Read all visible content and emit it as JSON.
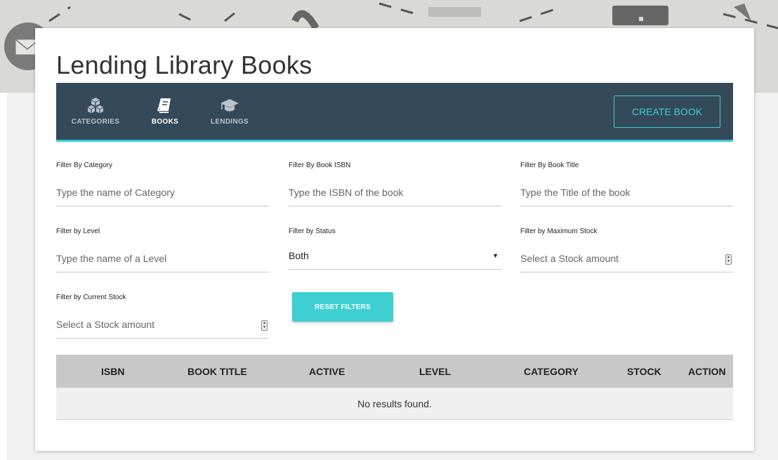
{
  "page": {
    "title": "Lending Library Books"
  },
  "nav": {
    "tabs": [
      {
        "label": "CATEGORIES",
        "icon": "boxes-icon",
        "active": false
      },
      {
        "label": "BOOKS",
        "icon": "book-icon",
        "active": true
      },
      {
        "label": "LENDINGS",
        "icon": "graduation-cap-icon",
        "active": false
      }
    ],
    "create_label": "CREATE BOOK"
  },
  "filters": {
    "category": {
      "label": "Filter By Category",
      "placeholder": "Type the name of Category"
    },
    "isbn": {
      "label": "Filter By Book ISBN",
      "placeholder": "Type the ISBN of the book"
    },
    "title": {
      "label": "Filter By Book Title",
      "placeholder": "Type the Title of the book"
    },
    "level": {
      "label": "Filter by Level",
      "placeholder": "Type the name of a Level"
    },
    "status": {
      "label": "Filter by Status",
      "value": "Both"
    },
    "max_stock": {
      "label": "Filter by Maximum Stock",
      "placeholder": "Select a Stock amount"
    },
    "current_stock": {
      "label": "Filter by Current Stock",
      "placeholder": "Select a Stock amount"
    },
    "reset_label": "RESET FILTERS"
  },
  "table": {
    "headers": [
      "ISBN",
      "BOOK TITLE",
      "ACTIVE",
      "LEVEL",
      "CATEGORY",
      "STOCK",
      "ACTION"
    ],
    "empty_message": "No results found."
  },
  "colors": {
    "accent": "#3dcfd1",
    "navbar": "#34495a",
    "header_row": "#c8c8c8"
  }
}
